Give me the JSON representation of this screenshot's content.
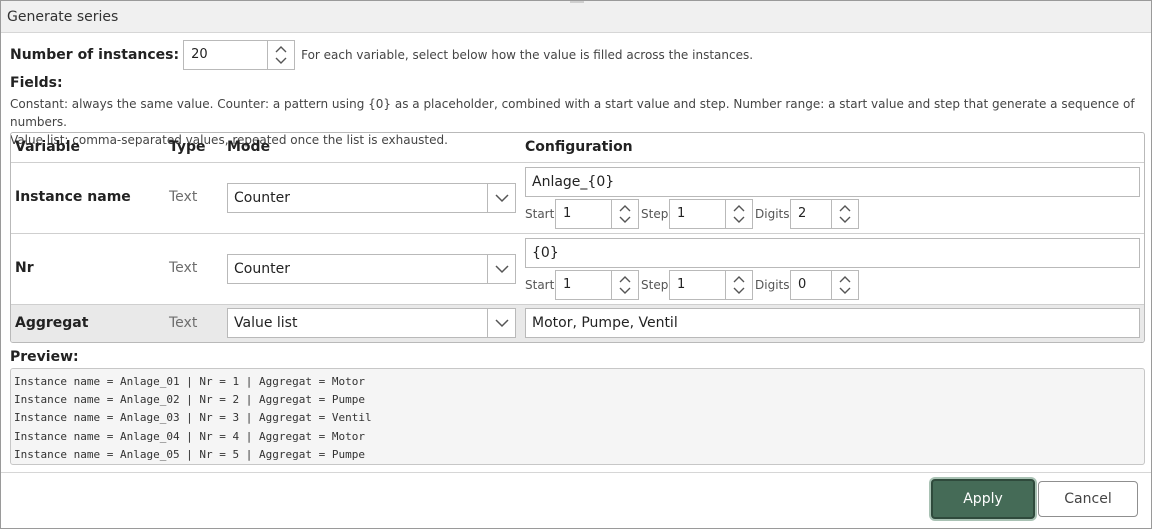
{
  "window": {
    "title": "Generate series"
  },
  "instances": {
    "label": "Number of instances:",
    "value": "20",
    "hint": "For each variable, select below how the value is filled across the instances."
  },
  "fields": {
    "label": "Fields:",
    "description_line1": "Constant: always the same value. Counter: a pattern using {0} as a placeholder, combined with a start value and step. Number range: a start value and step that generate a sequence of numbers.",
    "description_line2": "Value list: comma-separated values, repeated once the list is exhausted."
  },
  "table": {
    "headers": {
      "variable": "Variable",
      "type": "Type",
      "mode": "Mode",
      "configuration": "Configuration"
    },
    "rows": [
      {
        "variable": "Instance name",
        "type": "Text",
        "mode": "Counter",
        "config": "Anlage_{0}",
        "start_label": "Start",
        "start": "1",
        "step_label": "Step",
        "step": "1",
        "digits_label": "Digits",
        "digits": "2"
      },
      {
        "variable": "Nr",
        "type": "Text",
        "mode": "Counter",
        "config": "{0}",
        "start_label": "Start",
        "start": "1",
        "step_label": "Step",
        "step": "1",
        "digits_label": "Digits",
        "digits": "0"
      },
      {
        "variable": "Aggregat",
        "type": "Text",
        "mode": "Value list",
        "config": "Motor, Pumpe, Ventil",
        "selected": true
      }
    ]
  },
  "preview": {
    "label": "Preview:",
    "lines": [
      "Instance name = Anlage_01 | Nr = 1 | Aggregat = Motor",
      "Instance name = Anlage_02 | Nr = 2 | Aggregat = Pumpe",
      "Instance name = Anlage_03 | Nr = 3 | Aggregat = Ventil",
      "Instance name = Anlage_04 | Nr = 4 | Aggregat = Motor",
      "Instance name = Anlage_05 | Nr = 5 | Aggregat = Pumpe"
    ]
  },
  "buttons": {
    "apply": "Apply",
    "cancel": "Cancel"
  },
  "colors": {
    "primary": "#456b57",
    "selected_row": "#e9e9e9",
    "preview_bg": "#f5f5f5"
  },
  "icons": {
    "spin_up": "chevron-up-icon",
    "spin_down": "chevron-down-icon",
    "dropdown": "chevron-down-icon"
  }
}
